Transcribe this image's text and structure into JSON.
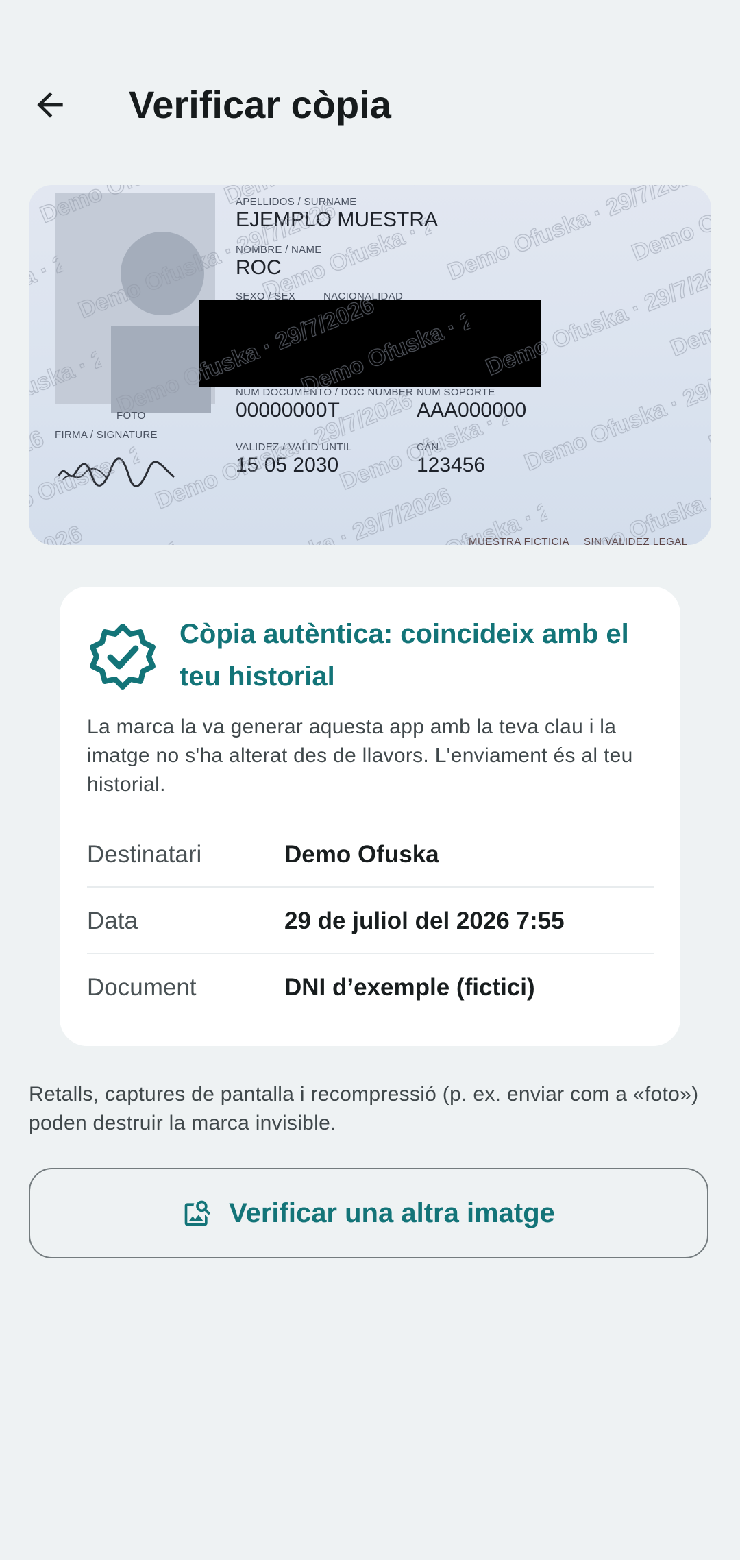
{
  "appbar": {
    "back_icon": "arrow-left-icon",
    "title": "Verificar còpia"
  },
  "id_card": {
    "photo_label": "FOTO",
    "signature_label": "FIRMA / SIGNATURE",
    "surname_label": "APELLIDOS / SURNAME",
    "surname_value": "EJEMPLO MUESTRA",
    "name_label": "NOMBRE / NAME",
    "name_value": "ROC",
    "sex_label": "SEXO / SEX",
    "nationality_label": "NACIONALIDAD",
    "doc_number_label": "NUM DOCUMENTO / DOC NUMBER",
    "doc_number_value": "00000000T",
    "support_label": "NUM SOPORTE",
    "support_value": "AAA000000",
    "valid_label": "VALIDEZ / VALID UNTIL",
    "valid_value": "15 05 2030",
    "can_label": "CAN",
    "can_value": "123456",
    "footer_left": "MUESTRA FICTICIA",
    "footer_right": "SIN VALIDEZ LEGAL",
    "watermark_text": "Demo Ofuska · 29/7/2026"
  },
  "result": {
    "icon": "verified-badge-icon",
    "title": "Còpia autèntica: coincideix amb el teu historial",
    "description": "La marca la va generar aquesta app amb la teva clau i la imatge no s'ha alterat des de llavors. L'enviament és al teu historial.",
    "rows": [
      {
        "key": "Destinatari",
        "value": "Demo Ofuska"
      },
      {
        "key": "Data",
        "value": "29 de juliol del 2026 7:55"
      },
      {
        "key": "Document",
        "value": "DNI d’exemple (fictici)"
      }
    ]
  },
  "note": "Retalls, captures de pantalla i recompressió (p. ex. enviar com a «foto») poden destruir la marca invisible.",
  "action": {
    "icon": "image-search-icon",
    "label": "Verificar una altra imatge"
  },
  "colors": {
    "accent": "#137478",
    "background": "#eef2f3"
  }
}
